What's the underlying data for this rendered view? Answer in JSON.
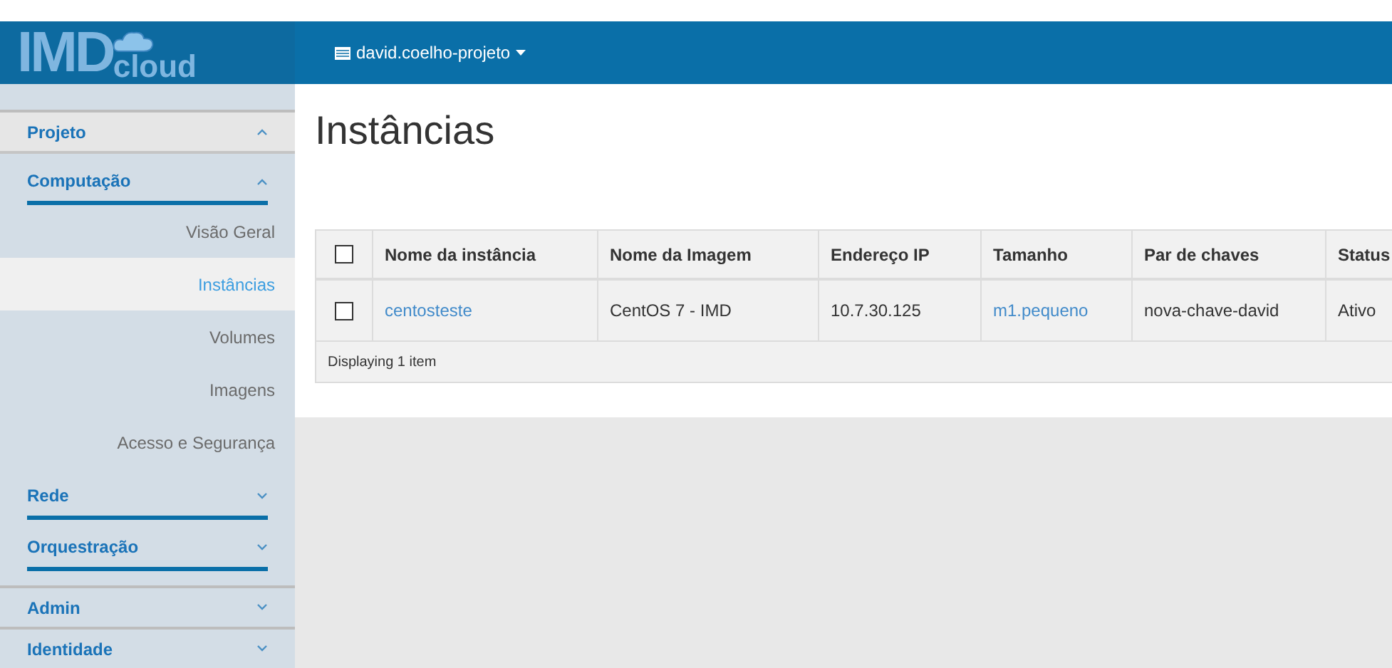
{
  "header": {
    "logo": {
      "main": "IMD",
      "sub": "cloud"
    },
    "project_menu": "david.coelho-projeto"
  },
  "sidebar": {
    "sections": [
      {
        "label": "Projeto",
        "expanded": true,
        "children": [
          {
            "label": "Computação",
            "expanded": true,
            "items": [
              {
                "label": "Visão Geral",
                "selected": false
              },
              {
                "label": "Instâncias",
                "selected": true
              },
              {
                "label": "Volumes",
                "selected": false
              },
              {
                "label": "Imagens",
                "selected": false
              },
              {
                "label": "Acesso e Segurança",
                "selected": false
              }
            ]
          },
          {
            "label": "Rede",
            "expanded": false
          },
          {
            "label": "Orquestração",
            "expanded": false
          }
        ]
      },
      {
        "label": "Admin",
        "expanded": false
      },
      {
        "label": "Identidade",
        "expanded": false
      }
    ]
  },
  "page": {
    "title": "Instâncias"
  },
  "table": {
    "select_all_checked": false,
    "columns": [
      "Nome da instância",
      "Nome da Imagem",
      "Endereço IP",
      "Tamanho",
      "Par de chaves",
      "Status"
    ],
    "rows": [
      {
        "checked": false,
        "cells": [
          {
            "kind": "link",
            "text": "centosteste"
          },
          {
            "kind": "text",
            "text": "CentOS 7 - IMD"
          },
          {
            "kind": "text",
            "text": "10.7.30.125"
          },
          {
            "kind": "link",
            "text": "m1.pequeno"
          },
          {
            "kind": "text",
            "text": "nova-chave-david"
          },
          {
            "kind": "text",
            "text": "Ativo"
          }
        ]
      }
    ],
    "footer": "Displaying 1 item"
  }
}
